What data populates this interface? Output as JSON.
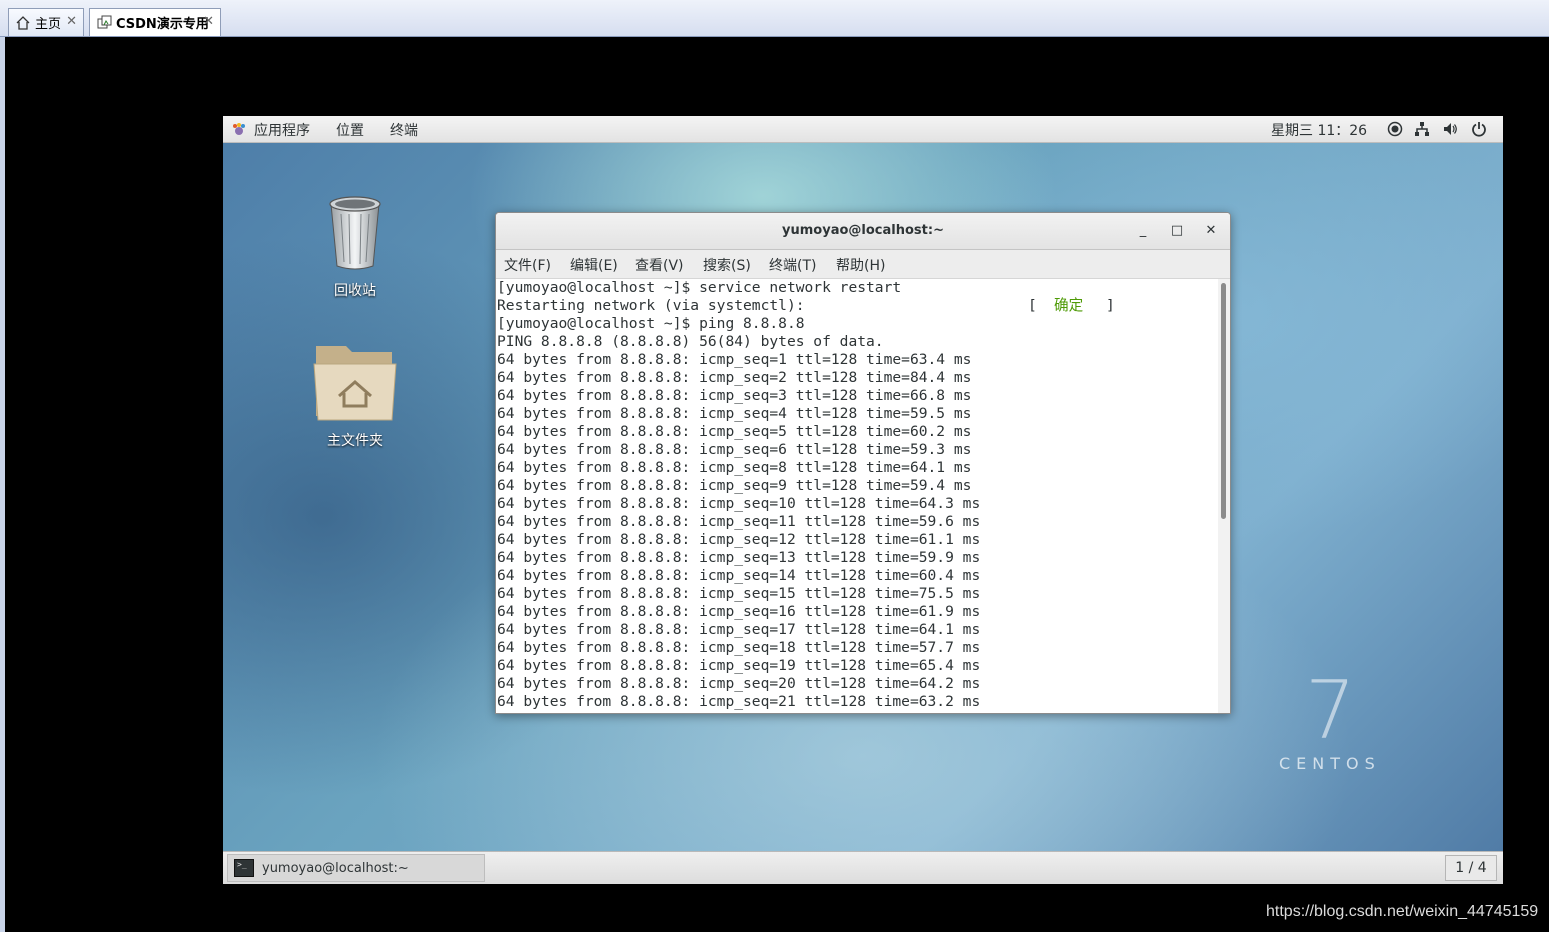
{
  "host": {
    "tabs": [
      {
        "label": "主页",
        "close": "✕"
      },
      {
        "label": "CSDN演示专用",
        "close": "✕"
      }
    ]
  },
  "topbar": {
    "menus": [
      "应用程序",
      "位置",
      "终端"
    ],
    "clock": "星期三 11：26"
  },
  "desktop": {
    "icons": [
      {
        "label": "回收站"
      },
      {
        "label": "主文件夹"
      }
    ],
    "brand_number": "7",
    "brand_text": "CENTOS"
  },
  "terminal": {
    "title": "yumoyao@localhost:~",
    "window_buttons": {
      "minimize": "_",
      "maximize": "□",
      "close": "✕"
    },
    "menus": [
      "文件(F)",
      "编辑(E)",
      "查看(V)",
      "搜索(S)",
      "终端(T)",
      "帮助(H)"
    ],
    "lines": [
      "[yumoyao@localhost ~]$ service network restart",
      "Restarting network (via systemctl):",
      "[yumoyao@localhost ~]$ ping 8.8.8.8",
      "PING 8.8.8.8 (8.8.8.8) 56(84) bytes of data.",
      "64 bytes from 8.8.8.8: icmp_seq=1 ttl=128 time=63.4 ms",
      "64 bytes from 8.8.8.8: icmp_seq=2 ttl=128 time=84.4 ms",
      "64 bytes from 8.8.8.8: icmp_seq=3 ttl=128 time=66.8 ms",
      "64 bytes from 8.8.8.8: icmp_seq=4 ttl=128 time=59.5 ms",
      "64 bytes from 8.8.8.8: icmp_seq=5 ttl=128 time=60.2 ms",
      "64 bytes from 8.8.8.8: icmp_seq=6 ttl=128 time=59.3 ms",
      "64 bytes from 8.8.8.8: icmp_seq=8 ttl=128 time=64.1 ms",
      "64 bytes from 8.8.8.8: icmp_seq=9 ttl=128 time=59.4 ms",
      "64 bytes from 8.8.8.8: icmp_seq=10 ttl=128 time=64.3 ms",
      "64 bytes from 8.8.8.8: icmp_seq=11 ttl=128 time=59.6 ms",
      "64 bytes from 8.8.8.8: icmp_seq=12 ttl=128 time=61.1 ms",
      "64 bytes from 8.8.8.8: icmp_seq=13 ttl=128 time=59.9 ms",
      "64 bytes from 8.8.8.8: icmp_seq=14 ttl=128 time=60.4 ms",
      "64 bytes from 8.8.8.8: icmp_seq=15 ttl=128 time=75.5 ms",
      "64 bytes from 8.8.8.8: icmp_seq=16 ttl=128 time=61.9 ms",
      "64 bytes from 8.8.8.8: icmp_seq=17 ttl=128 time=64.1 ms",
      "64 bytes from 8.8.8.8: icmp_seq=18 ttl=128 time=57.7 ms",
      "64 bytes from 8.8.8.8: icmp_seq=19 ttl=128 time=65.4 ms",
      "64 bytes from 8.8.8.8: icmp_seq=20 ttl=128 time=64.2 ms",
      "64 bytes from 8.8.8.8: icmp_seq=21 ttl=128 time=63.2 ms"
    ],
    "status_open": "[",
    "status_ok": "确定",
    "status_close": "]"
  },
  "bottombar": {
    "task_label": "yumoyao@localhost:~",
    "workspace": "1 / 4"
  },
  "watermark": "https://blog.csdn.net/weixin_44745159"
}
